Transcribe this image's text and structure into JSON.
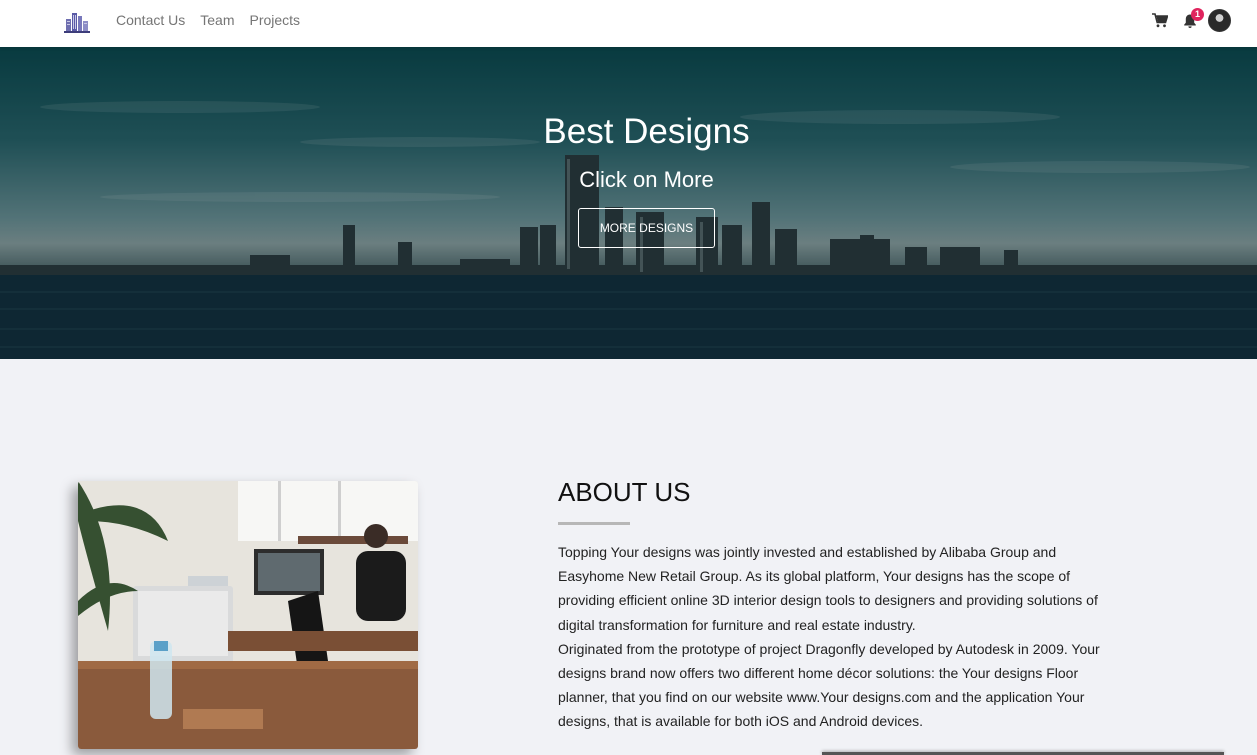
{
  "nav": {
    "links": [
      "Contact Us",
      "Team",
      "Projects"
    ],
    "notification_count": "1"
  },
  "hero": {
    "title": "Best Designs",
    "subtitle": "Click on More",
    "button_label": "MORE DESIGNS"
  },
  "about": {
    "title": "ABOUT US",
    "paragraph_1": "Topping Your designs was jointly invested and established by Alibaba Group and Easyhome New Retail Group. As its global platform, Your designs has the scope of providing efficient online 3D interior design tools to designers and providing solutions of digital transformation for furniture and real estate industry.",
    "paragraph_2": "Originated from the prototype of project Dragonfly developed by Autodesk in 2009. Your designs brand now offers two different home décor solutions: the Your designs Floor planner, that you find on our website www.Your designs.com and the application Your designs, that is available for both iOS and Android devices."
  },
  "icons": {
    "logo": "building-logo-icon",
    "cart": "cart-icon",
    "bell": "bell-icon",
    "avatar": "avatar"
  },
  "colors": {
    "badge": "#e0245e",
    "page_bg": "#f1f2f6",
    "nav_link": "#757575"
  }
}
